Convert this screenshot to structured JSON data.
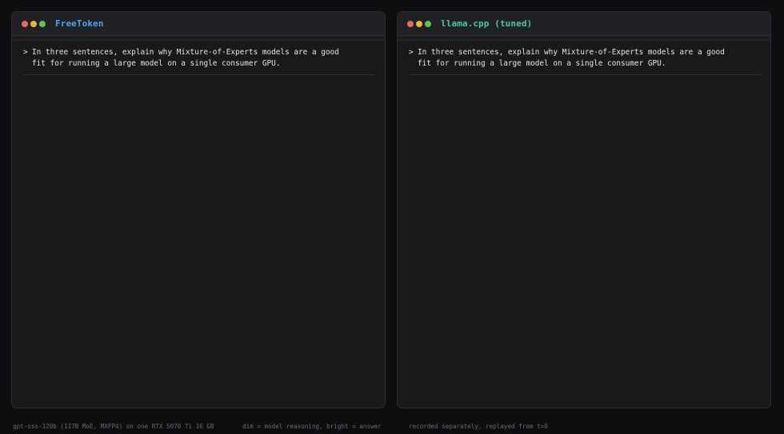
{
  "panes": [
    {
      "title": "FreeToken",
      "title_color": "#4da3f2",
      "prompt_caret": ">",
      "prompt_line1": "In three sentences, explain why Mixture-of-Experts models are a good",
      "prompt_line2": "fit for running a large model on a single consumer GPU."
    },
    {
      "title": "llama.cpp (tuned)",
      "title_color": "#49c9a0",
      "prompt_caret": ">",
      "prompt_line1": "In three sentences, explain why Mixture-of-Experts models are a good",
      "prompt_line2": "fit for running a large model on a single consumer GPU."
    }
  ],
  "footer": {
    "model_info": "gpt-oss-120b (117B MoE, MXFP4) on one RTX 5070 Ti 16 GB",
    "legend": "dim = model reasoning, bright = answer",
    "note": "recorded separately, replayed from t=0"
  },
  "colors": {
    "window_dot_close": "#e86a5f",
    "window_dot_minimize": "#e8b53e",
    "window_dot_maximize": "#5fc35a"
  }
}
